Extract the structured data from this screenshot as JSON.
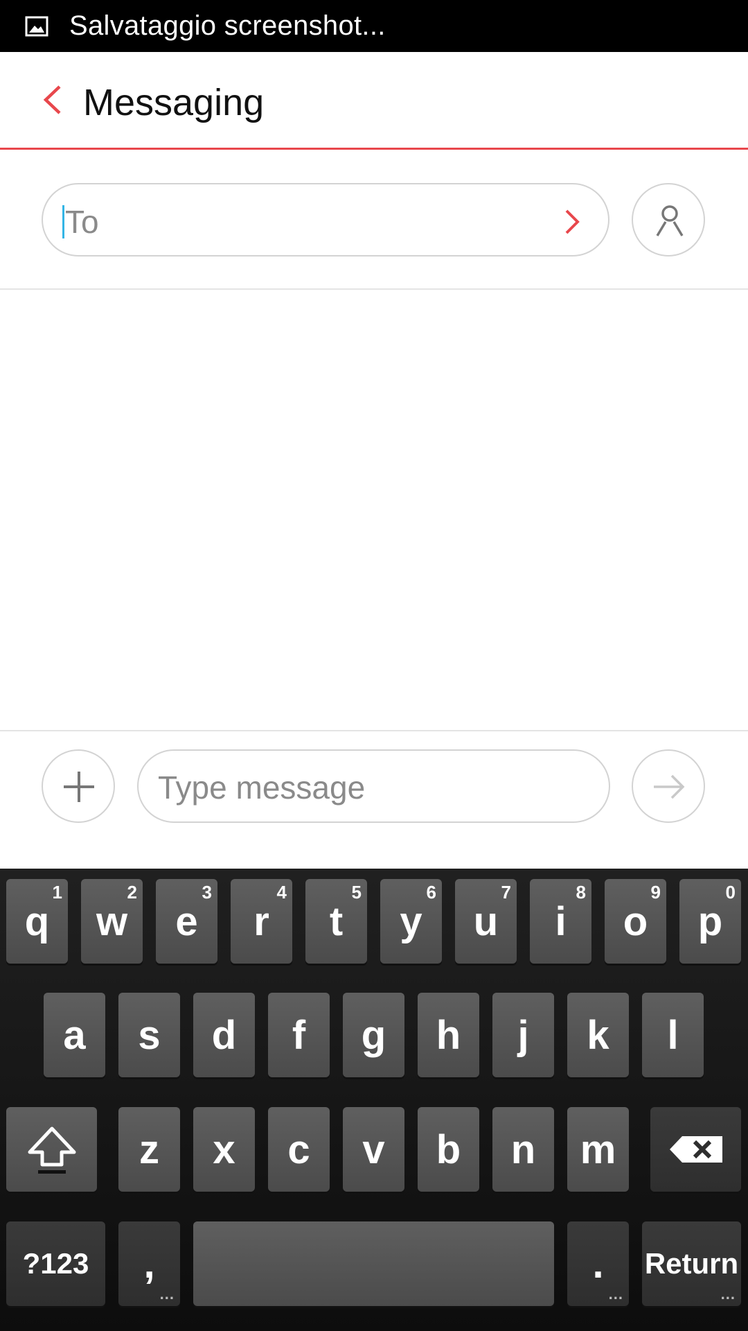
{
  "status_bar": {
    "notification_icon": "image-icon",
    "text": "Salvataggio screenshot..."
  },
  "header": {
    "back_icon": "chevron-left-icon",
    "title": "Messaging",
    "accent_color": "#e8474c"
  },
  "recipient": {
    "placeholder": "To",
    "go_icon": "chevron-right-icon",
    "contact_icon": "person-icon"
  },
  "compose": {
    "attach_icon": "plus-icon",
    "placeholder": "Type message",
    "send_icon": "arrow-right-icon"
  },
  "keyboard": {
    "row1": [
      {
        "label": "q",
        "hint": "1"
      },
      {
        "label": "w",
        "hint": "2"
      },
      {
        "label": "e",
        "hint": "3"
      },
      {
        "label": "r",
        "hint": "4"
      },
      {
        "label": "t",
        "hint": "5"
      },
      {
        "label": "y",
        "hint": "6"
      },
      {
        "label": "u",
        "hint": "7"
      },
      {
        "label": "i",
        "hint": "8"
      },
      {
        "label": "o",
        "hint": "9"
      },
      {
        "label": "p",
        "hint": "0"
      }
    ],
    "row2": [
      "a",
      "s",
      "d",
      "f",
      "g",
      "h",
      "j",
      "k",
      "l"
    ],
    "row3": [
      "z",
      "x",
      "c",
      "v",
      "b",
      "n",
      "m"
    ],
    "shift_icon": "shift-arrow-icon",
    "backspace_icon": "backspace-icon",
    "symbols_label": "?123",
    "comma_label": ",",
    "period_label": ".",
    "return_label": "Return",
    "more_dots": "..."
  }
}
